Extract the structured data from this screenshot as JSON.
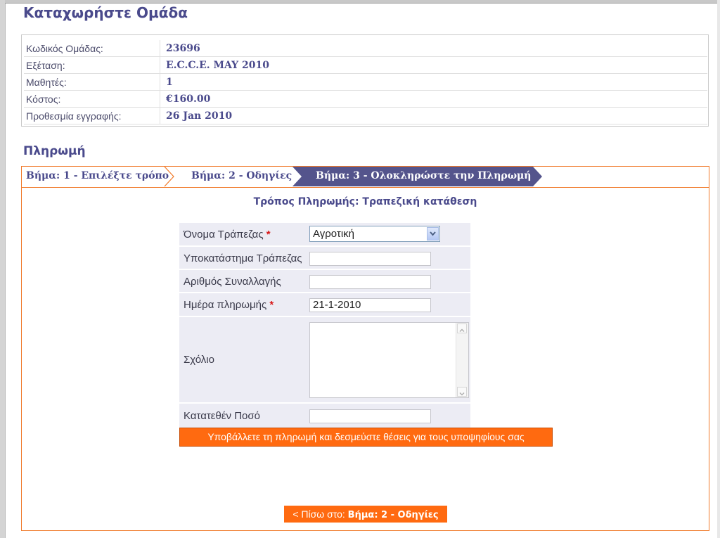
{
  "page": {
    "title": "Καταχωρήστε Ομάδα"
  },
  "group_info": {
    "rows": [
      {
        "label": "Κωδικός Ομάδας:",
        "value": "23696"
      },
      {
        "label": "Εξέταση:",
        "value": "E.C.C.E. MAY 2010"
      },
      {
        "label": "Μαθητές:",
        "value": "1"
      },
      {
        "label": "Κόστος:",
        "value": "€160.00"
      },
      {
        "label": "Προθεσμία εγγραφής:",
        "value": "26 Jan 2010"
      }
    ]
  },
  "payment": {
    "section_title": "Πληρωμή",
    "steps": [
      {
        "label": "Βήμα: 1 - Επιλέξτε τρόπο",
        "state": "done"
      },
      {
        "label": "Βήμα: 2 - Οδηγίες",
        "state": "done"
      },
      {
        "label": "Βήμα: 3 - Ολοκληρώστε την Πληρωμή",
        "state": "active"
      }
    ],
    "method_title": "Τρόπος Πληρωμής: Τραπεζική κατάθεση",
    "form": {
      "bank_name": {
        "label": "Όνομα Τράπεζας",
        "required_mark": "*",
        "value": "Αγροτική"
      },
      "bank_branch": {
        "label": "Υποκατάστημα Τράπεζας",
        "value": ""
      },
      "transaction_number": {
        "label": "Αριθμός Συναλλαγής",
        "value": ""
      },
      "payment_date": {
        "label": "Ημέρα πληρωμής",
        "required_mark": "*",
        "value": "21-1-2010"
      },
      "comment": {
        "label": "Σχόλιο",
        "value": ""
      },
      "deposited_amount": {
        "label": "Κατατεθέν Ποσό",
        "value": ""
      }
    },
    "submit_label": "Υποβάλλετε τη πληρωμή και δεσμεύστε θέσεις για τους υποψηφίους σας",
    "back": {
      "prefix": "< Πίσω στο: ",
      "target": "Βήμα: 2 - Οδηγίες"
    }
  },
  "colors": {
    "brand": "#4a4a8c",
    "accent": "#ff6a10",
    "border_accent": "#f07a2a",
    "required": "#d81818",
    "form_row_bg": "#ececf4"
  }
}
